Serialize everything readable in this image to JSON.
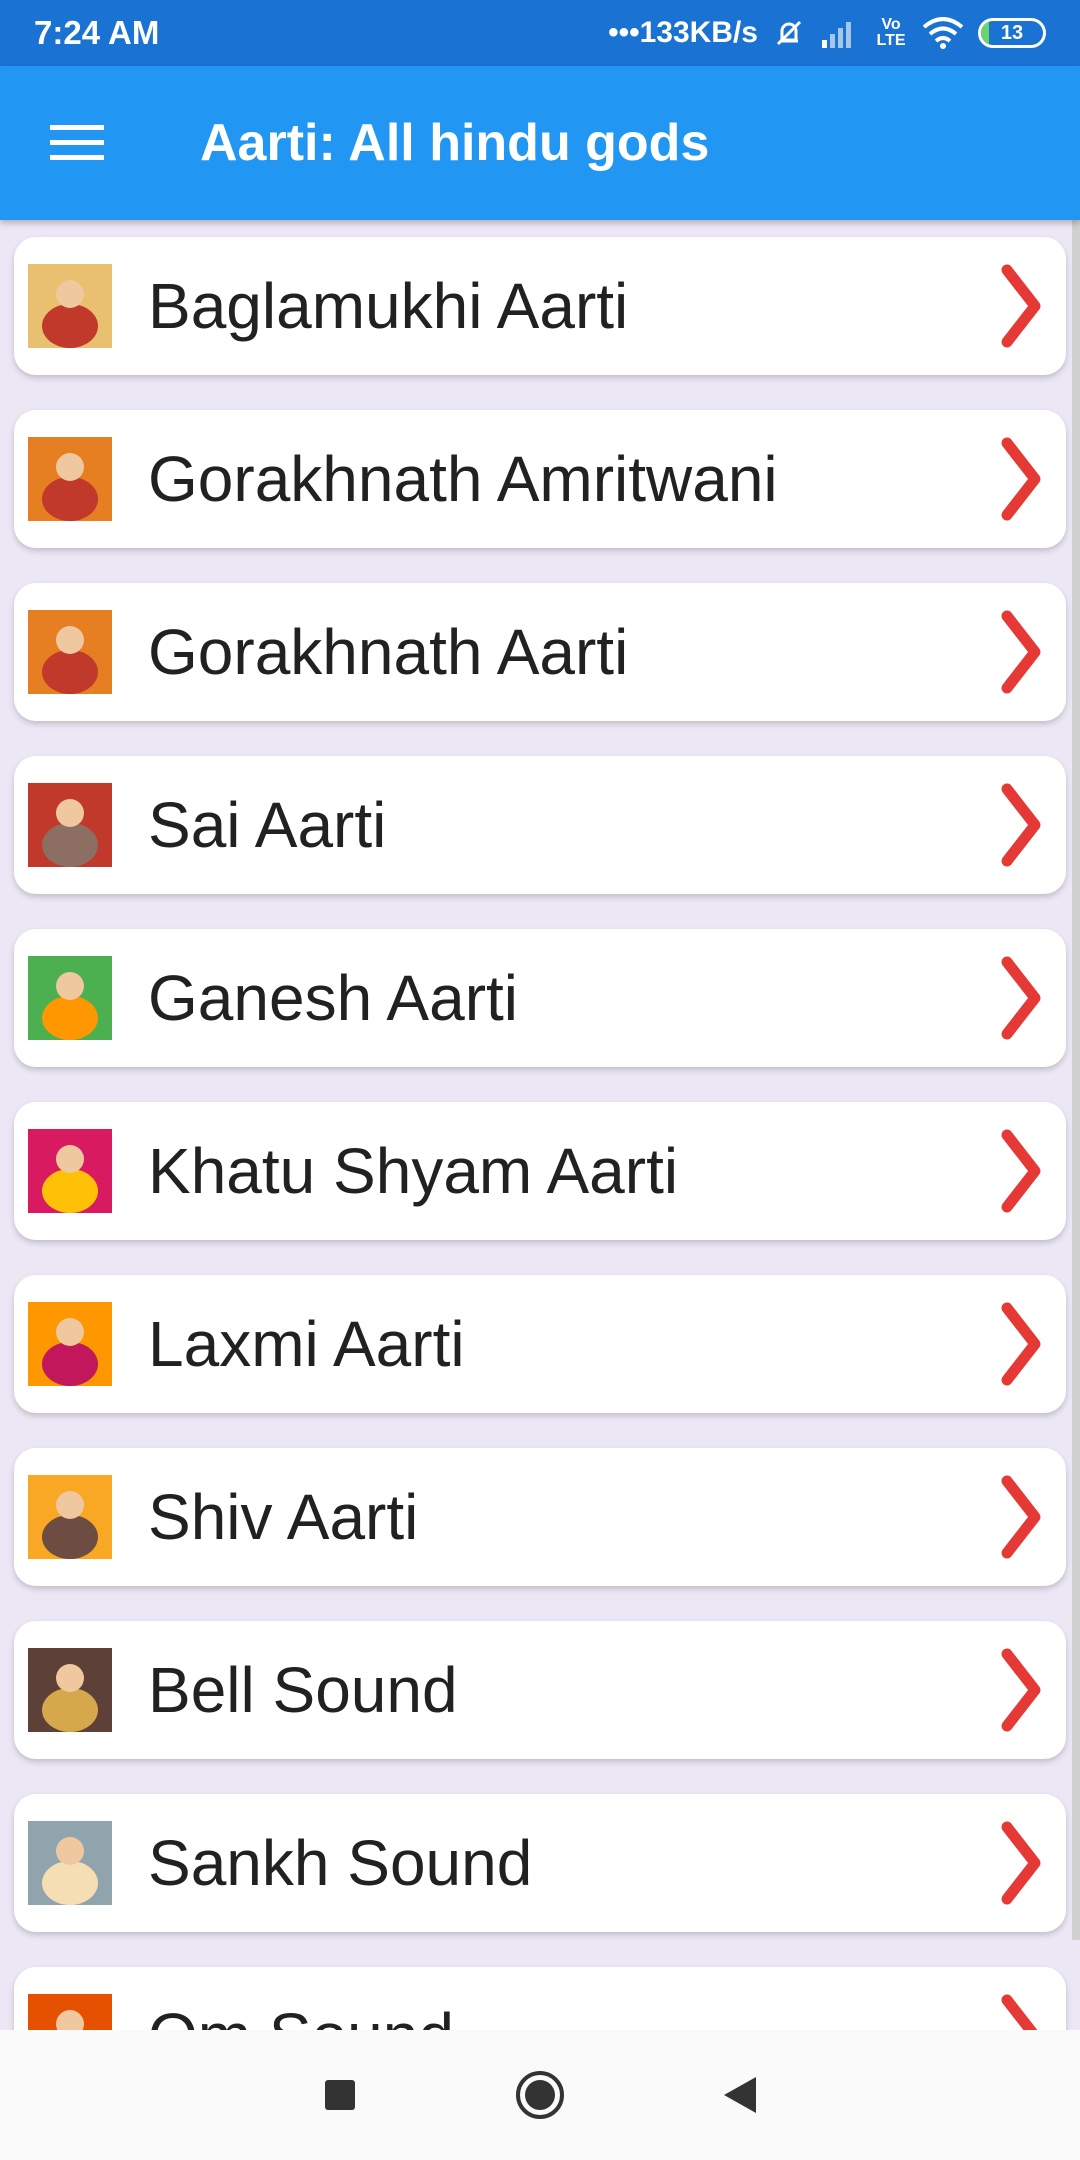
{
  "status_bar": {
    "time": "7:24 AM",
    "speed": "•••133KB/s",
    "network": "Vo LTE",
    "battery": "13",
    "battery_level": 0.13
  },
  "app_bar": {
    "title": "Aarti: All hindu gods",
    "menu_icon": "hamburger-menu-icon"
  },
  "colors": {
    "status_bar": "#1a73d2",
    "app_bar": "#2196f3",
    "background": "#ece7f5",
    "chevron": "#e53935"
  },
  "items": [
    {
      "label": "Baglamukhi Aarti",
      "thumb_color": "#e8c070",
      "thumb_accent": "#c0392b"
    },
    {
      "label": "Gorakhnath Amritwani",
      "thumb_color": "#e67e22",
      "thumb_accent": "#c0392b"
    },
    {
      "label": "Gorakhnath Aarti",
      "thumb_color": "#e67e22",
      "thumb_accent": "#c0392b"
    },
    {
      "label": "Sai Aarti",
      "thumb_color": "#c0392b",
      "thumb_accent": "#8d6e63"
    },
    {
      "label": "Ganesh Aarti",
      "thumb_color": "#4caf50",
      "thumb_accent": "#ff9800"
    },
    {
      "label": "Khatu Shyam Aarti",
      "thumb_color": "#d81b60",
      "thumb_accent": "#ffc107"
    },
    {
      "label": "Laxmi Aarti",
      "thumb_color": "#ff9800",
      "thumb_accent": "#c2185b"
    },
    {
      "label": "Shiv Aarti",
      "thumb_color": "#f9a825",
      "thumb_accent": "#6d4c41"
    },
    {
      "label": "Bell Sound",
      "thumb_color": "#5d4037",
      "thumb_accent": "#d4a84b"
    },
    {
      "label": "Sankh Sound",
      "thumb_color": "#90a4ae",
      "thumb_accent": "#f5deb3"
    },
    {
      "label": "Om Sound",
      "thumb_color": "#e65100",
      "thumb_accent": "#ffb300"
    }
  ],
  "nav_bar": {
    "recents_icon": "square-recents-icon",
    "home_icon": "circle-home-icon",
    "back_icon": "triangle-back-icon"
  }
}
